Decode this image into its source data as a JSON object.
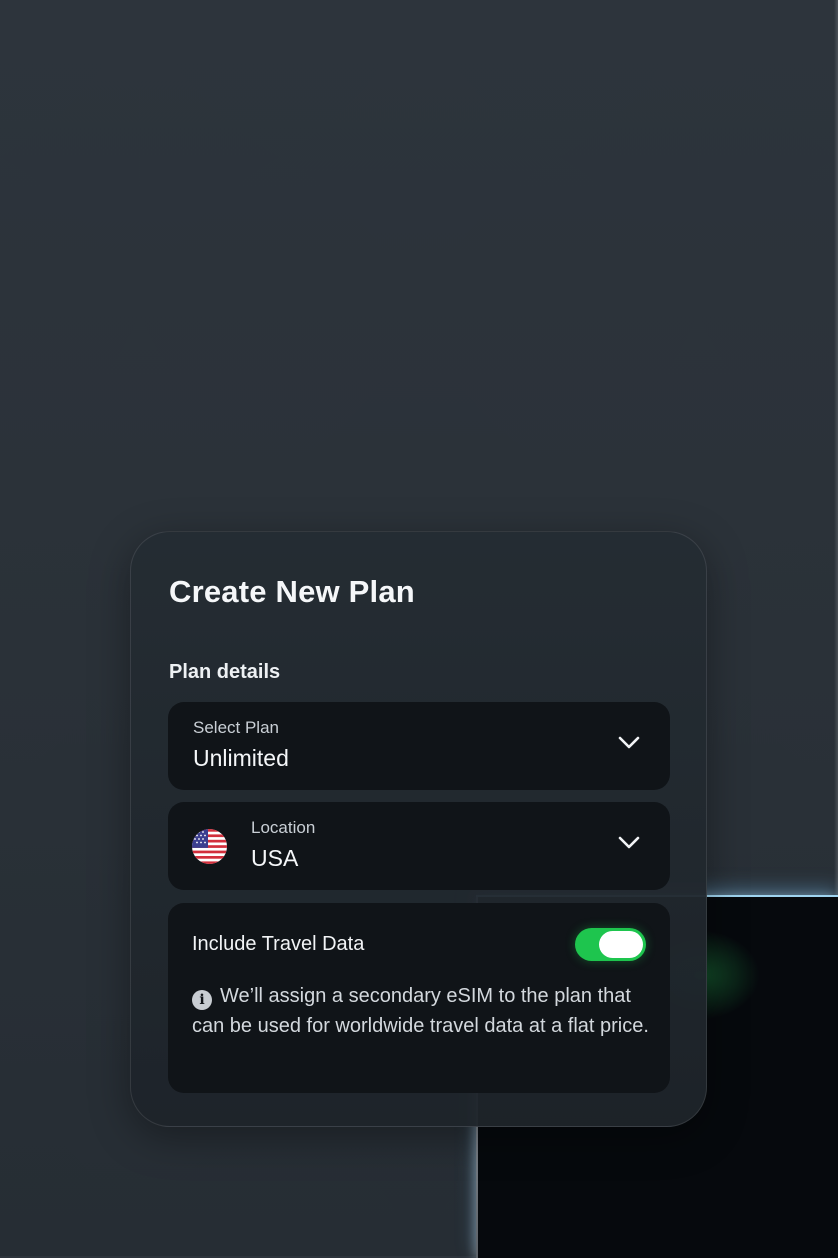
{
  "card": {
    "title": "Create New Plan",
    "section_label": "Plan details"
  },
  "plan_field": {
    "label": "Select Plan",
    "value": "Unlimited",
    "icon": "chevron-down-icon"
  },
  "location_field": {
    "label": "Location",
    "value": "USA",
    "flag_icon": "us-flag-icon",
    "icon": "chevron-down-icon"
  },
  "travel": {
    "label": "Include Travel Data",
    "toggle_on": true,
    "info_icon": "info-icon",
    "info_text": "We’ll assign a secondary eSIM to the plan that can be used for worldwide travel data at a flat price."
  },
  "colors": {
    "toggle_active": "#1ec54e",
    "card_background": "#252c33",
    "field_background": "#101418"
  }
}
